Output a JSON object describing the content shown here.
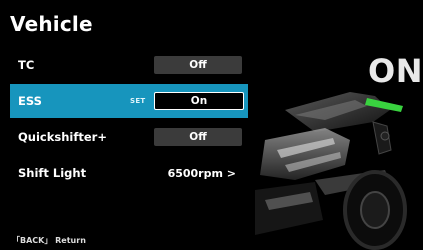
{
  "header": {
    "title": "Vehicle"
  },
  "menu": {
    "items": [
      {
        "label": "TC",
        "value": "Off"
      },
      {
        "label": "ESS",
        "tag": "SET",
        "value": "On"
      },
      {
        "label": "Quickshifter+",
        "value": "Off"
      },
      {
        "label": "Shift Light",
        "value": "6500rpm >"
      }
    ]
  },
  "preview": {
    "state": "ON"
  },
  "footer": {
    "back_hint": "「BACK」 Return"
  },
  "colors": {
    "selection": "#1795bd",
    "indicator": "#39d23f",
    "value_bg": "#3b3b3b"
  },
  "icons": {
    "preview_image": "motorcycle-rear-light-icon"
  }
}
